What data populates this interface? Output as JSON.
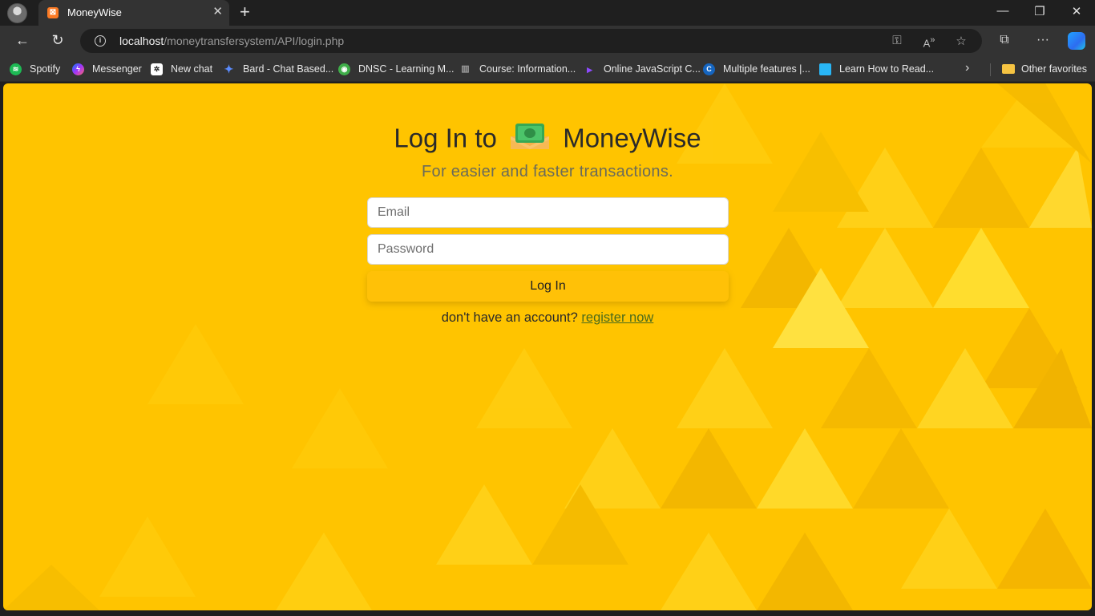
{
  "browser": {
    "tab": {
      "title": "MoneyWise",
      "favicon_color": "#fb7a24"
    },
    "address": {
      "host": "localhost",
      "path": "/moneytransfersystem/API/login.php"
    },
    "bookmarks": [
      {
        "label": "Spotify",
        "icon": "spotify-icon",
        "color": "#1db954"
      },
      {
        "label": "Messenger",
        "icon": "messenger-icon",
        "color": "#a334fa"
      },
      {
        "label": "New chat",
        "icon": "openai-icon",
        "color": "#ffffff"
      },
      {
        "label": "Bard - Chat Based...",
        "icon": "bard-sparkle-icon",
        "color": "#4285f4"
      },
      {
        "label": "DNSC - Learning M...",
        "icon": "dnsc-icon",
        "color": "#3fae49"
      },
      {
        "label": "Course: Information...",
        "icon": "course-icon",
        "color": "#888888"
      },
      {
        "label": "Online JavaScript C...",
        "icon": "javascript-compiler-icon",
        "color": "#7b3ff2"
      },
      {
        "label": "Multiple features |...",
        "icon": "c-icon",
        "color": "#1565c0"
      },
      {
        "label": "Learn How to Read...",
        "icon": "book-icon",
        "color": "#29b6f6"
      }
    ],
    "other_favorites": "Other favorites"
  },
  "page": {
    "heading_prefix": "Log In to",
    "brand": "MoneyWise",
    "subtitle": "For easier and faster transactions.",
    "email_placeholder": "Email",
    "password_placeholder": "Password",
    "login_button": "Log In",
    "register_prompt": "don't have an account?",
    "register_link": "register now",
    "colors": {
      "background": "#ffc400",
      "button": "#ffc107",
      "link": "#4a6b1c"
    }
  }
}
